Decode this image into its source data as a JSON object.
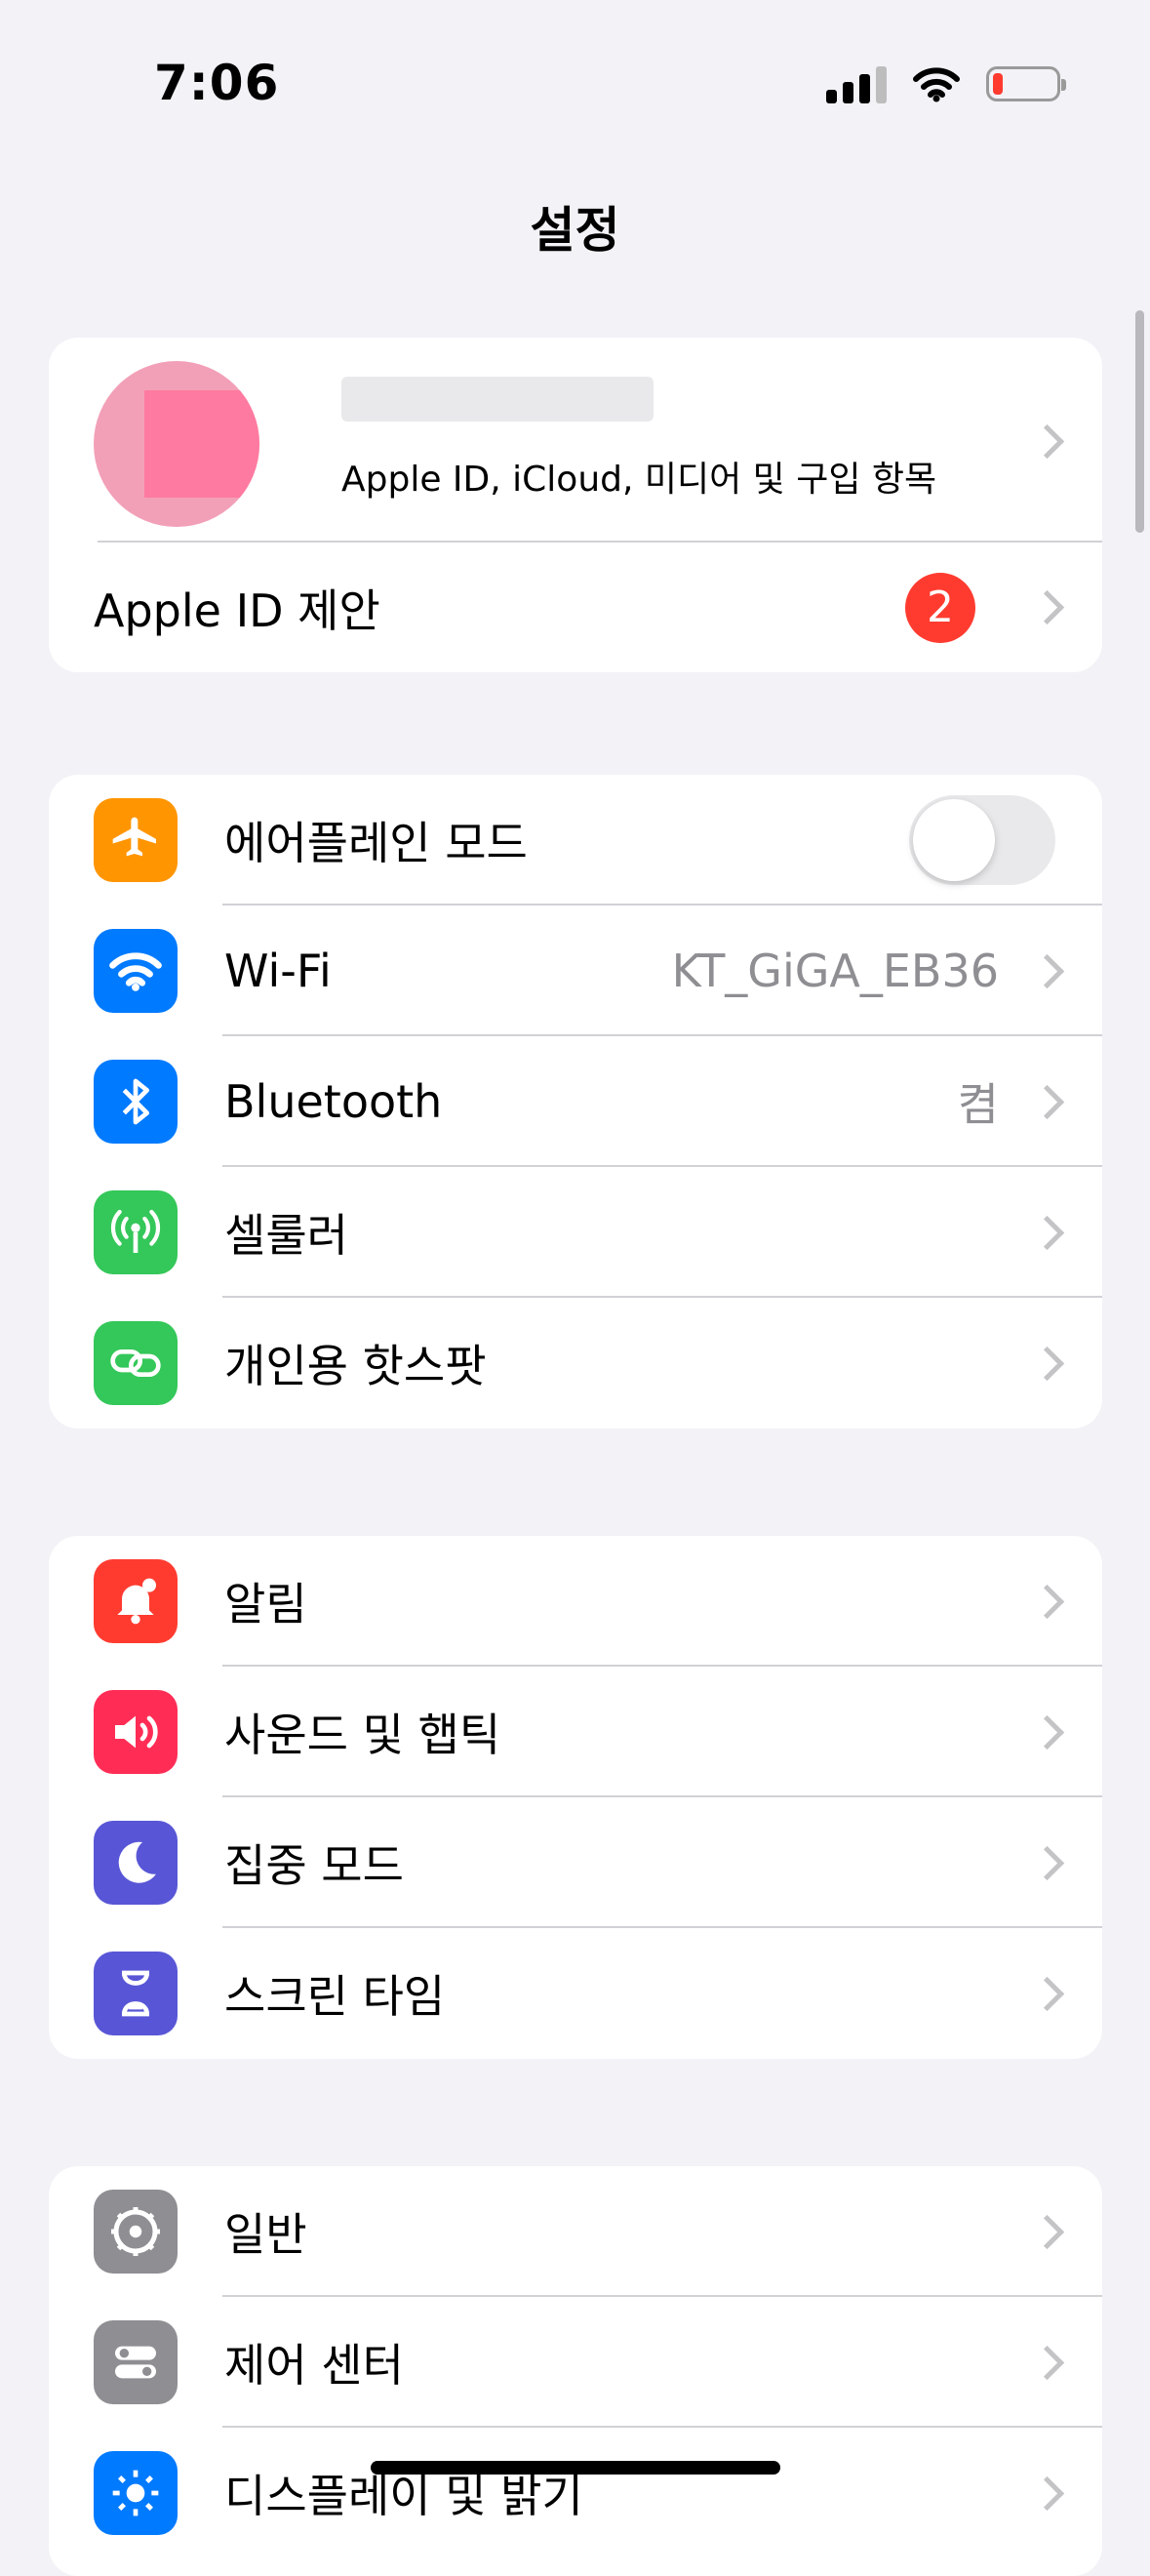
{
  "status": {
    "time": "7:06"
  },
  "nav": {
    "title": "설정"
  },
  "account": {
    "subtitle": "Apple ID, iCloud, 미디어 및 구입 항목",
    "row2_label": "Apple ID 제안",
    "badge": "2"
  },
  "group1": [
    {
      "label": "에어플레인 모드",
      "icon": "airplane-icon",
      "color": "#FF9500"
    },
    {
      "label": "Wi-Fi",
      "value": "KT_GiGA_EB36",
      "icon": "wifi-icon",
      "color": "#007AFF"
    },
    {
      "label": "Bluetooth",
      "value": "켬",
      "icon": "bluetooth-icon",
      "color": "#007AFF"
    },
    {
      "label": "셀룰러",
      "icon": "antenna-icon",
      "color": "#34C759"
    },
    {
      "label": "개인용 핫스팟",
      "icon": "link-icon",
      "color": "#34C759"
    }
  ],
  "group2": [
    {
      "label": "알림",
      "icon": "bell-icon",
      "color": "#FF3B30"
    },
    {
      "label": "사운드 및 햅틱",
      "icon": "speaker-icon",
      "color": "#FF2D55"
    },
    {
      "label": "집중 모드",
      "icon": "moon-icon",
      "color": "#5856D6"
    },
    {
      "label": "스크린 타임",
      "icon": "hourglass-icon",
      "color": "#5856D6"
    }
  ],
  "group3": [
    {
      "label": "일반",
      "icon": "gear-icon",
      "color": "#8E8E93"
    },
    {
      "label": "제어 센터",
      "icon": "toggles-icon",
      "color": "#8E8E93"
    },
    {
      "label": "디스플레이 및 밝기",
      "icon": "sun-icon",
      "color": "#007AFF"
    }
  ]
}
